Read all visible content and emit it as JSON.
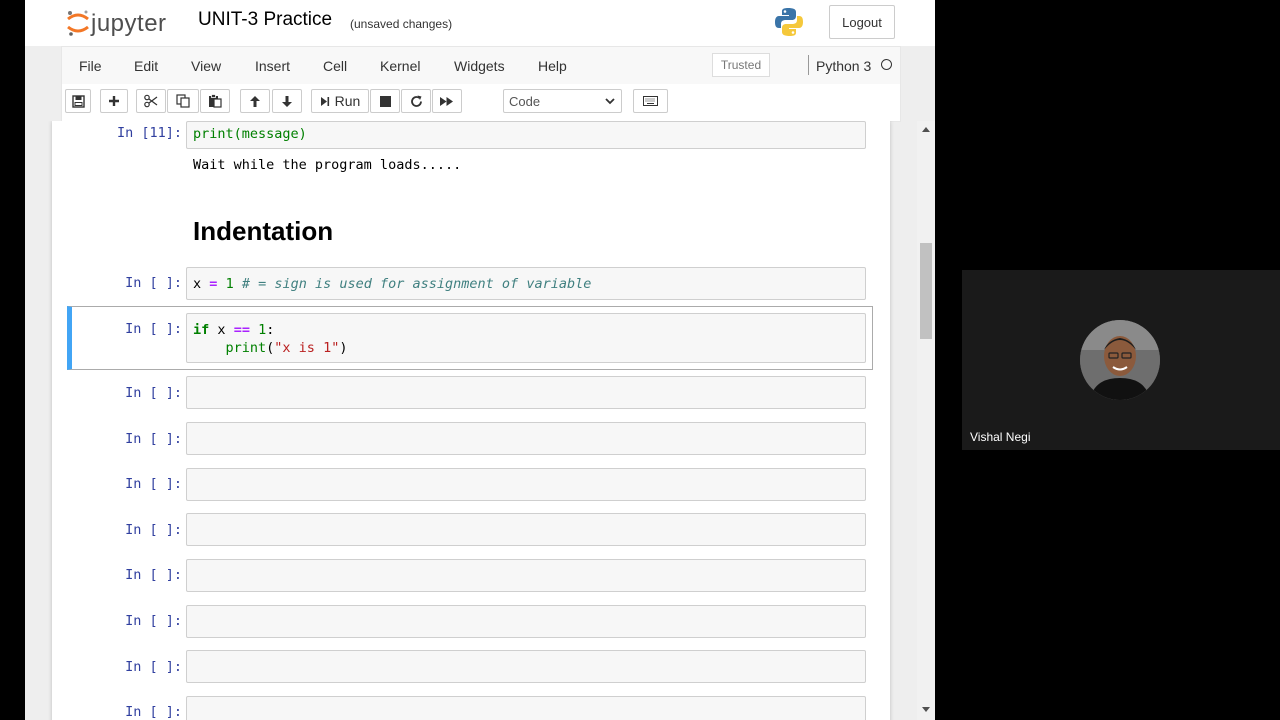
{
  "header": {
    "logo_text": "jupyter",
    "notebook_name": "UNIT-3 Practice",
    "save_status": "(unsaved changes)",
    "logout_label": "Logout"
  },
  "menubar": {
    "items": [
      "File",
      "Edit",
      "View",
      "Insert",
      "Cell",
      "Kernel",
      "Widgets",
      "Help"
    ],
    "trusted_label": "Trusted",
    "kernel_name": "Python 3"
  },
  "toolbar": {
    "run_label": "Run",
    "cell_type": "Code"
  },
  "cells": {
    "print_cell": {
      "prompt": "In [11]:",
      "code": "print(message)",
      "output": "Wait while the program loads....."
    },
    "markdown_heading": "Indentation",
    "assign_cell": {
      "prompt": "In [ ]:",
      "code_var": "x",
      "code_op": "=",
      "code_num": "1",
      "code_comment": "# = sign is used for assignment of variable"
    },
    "if_cell": {
      "prompt": "In [ ]:",
      "kw_if": "if",
      "var": "x",
      "op": "==",
      "num": "1",
      "colon": ":",
      "indent": "    ",
      "fn": "print",
      "str": "\"x is 1\""
    },
    "empty_prompt": "In [ ]:"
  },
  "video": {
    "participant_name": "Vishal Negi"
  },
  "colors": {
    "accent_selected": "#42a5f5",
    "prompt_in": "#303f9f",
    "keyword": "#008000",
    "operator": "#aa22ff",
    "string": "#ba2121",
    "comment": "#408080"
  }
}
